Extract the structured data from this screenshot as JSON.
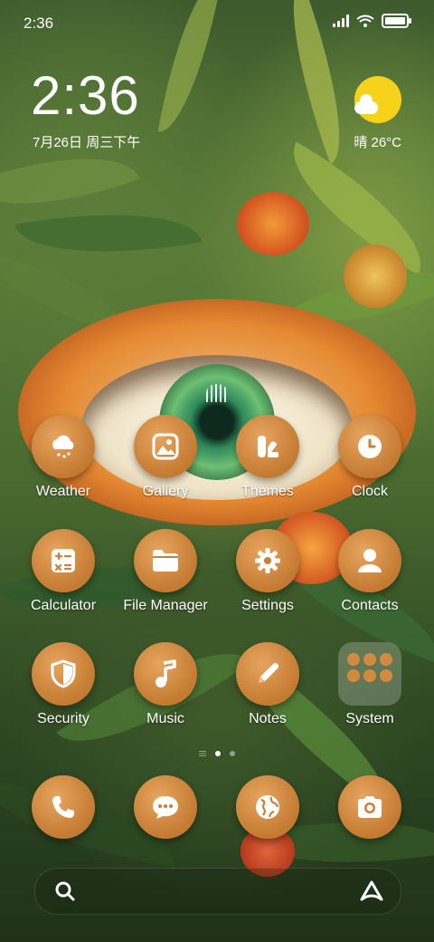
{
  "status_bar": {
    "time": "2:36",
    "battery_level": 0.85
  },
  "widget": {
    "clock": "2:36",
    "date": "7月26日 周三下午",
    "weather": "晴 26°C"
  },
  "apps": [
    {
      "label": "Weather",
      "icon": "cloud-rain-icon"
    },
    {
      "label": "Gallery",
      "icon": "image-icon"
    },
    {
      "label": "Themes",
      "icon": "themes-icon"
    },
    {
      "label": "Clock",
      "icon": "clock-icon"
    },
    {
      "label": "Calculator",
      "icon": "calculator-icon"
    },
    {
      "label": "File Manager",
      "icon": "folder-icon"
    },
    {
      "label": "Settings",
      "icon": "gear-icon"
    },
    {
      "label": "Contacts",
      "icon": "person-icon"
    },
    {
      "label": "Security",
      "icon": "shield-icon"
    },
    {
      "label": "Music",
      "icon": "music-note-icon"
    },
    {
      "label": "Notes",
      "icon": "pencil-icon"
    },
    {
      "label": "System",
      "icon": "folder-grid-icon"
    }
  ],
  "dock": [
    {
      "icon": "phone-icon"
    },
    {
      "icon": "message-icon"
    },
    {
      "icon": "globe-icon"
    },
    {
      "icon": "camera-icon"
    }
  ],
  "pager": {
    "current": 1,
    "pages": 2
  },
  "search": {
    "icon": "search-icon",
    "assistant_icon": "assistant-icon"
  },
  "colors": {
    "icon_bg": "#c98037",
    "accent": "#f7d21a"
  }
}
